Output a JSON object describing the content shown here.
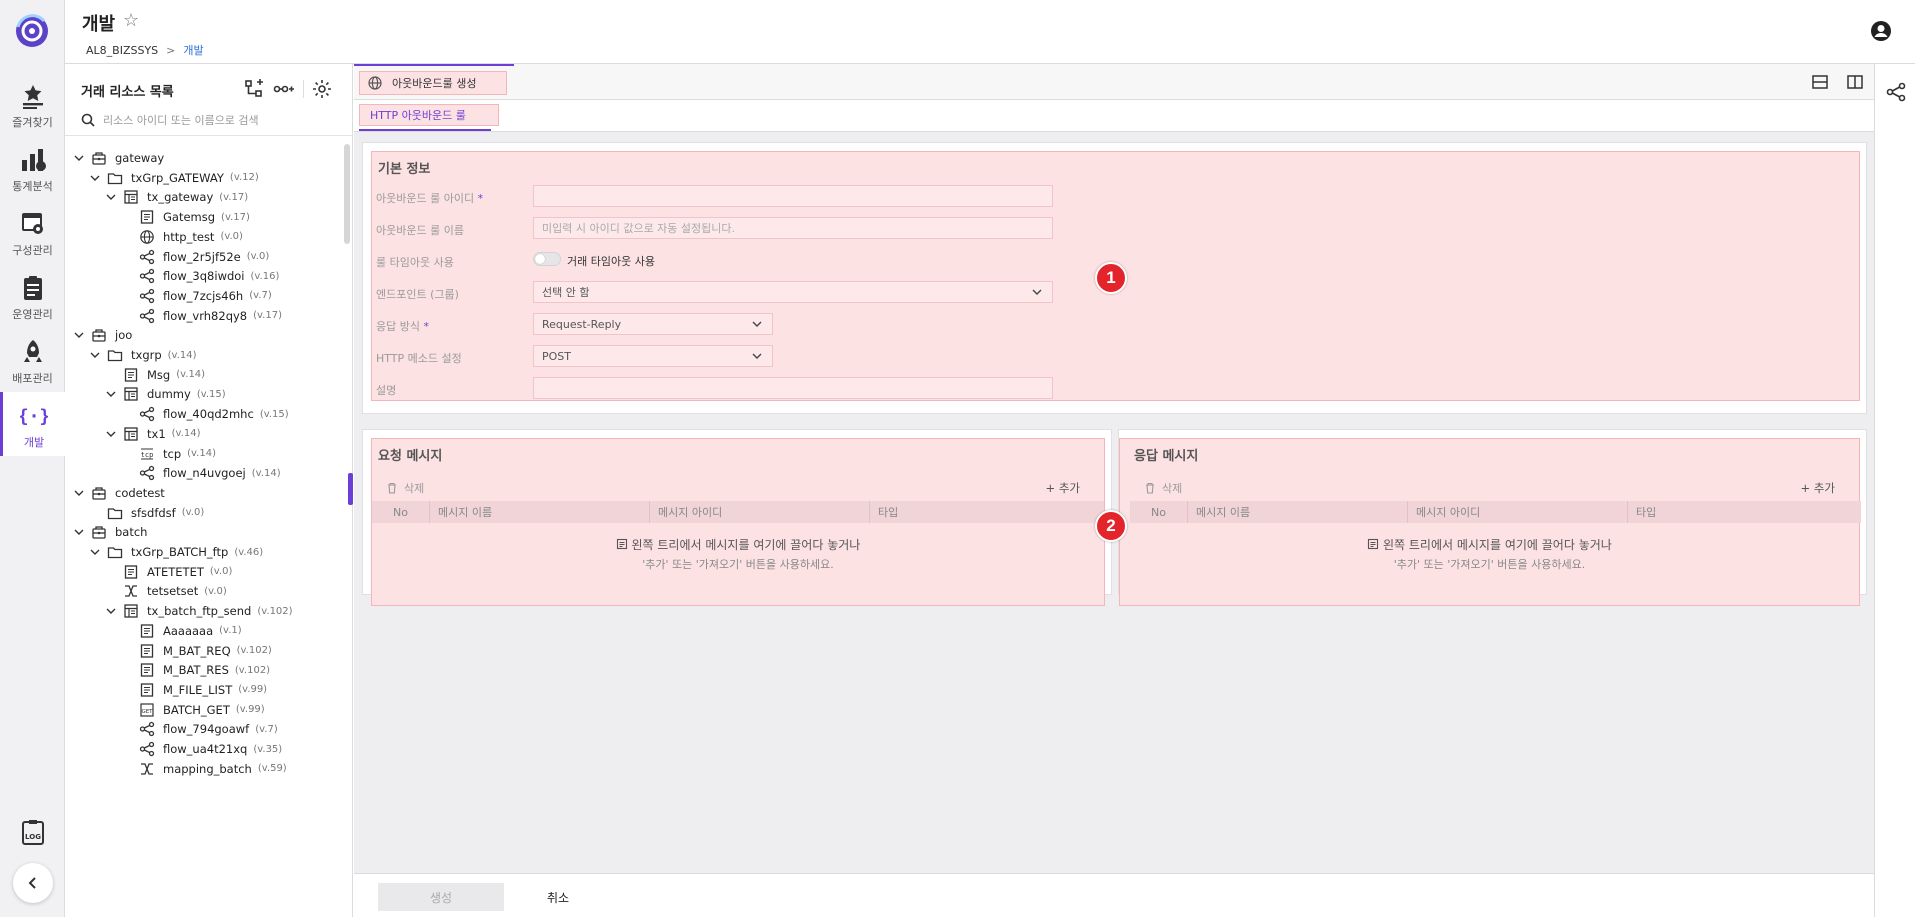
{
  "header": {
    "title": "개발",
    "breadcrumb_root": "AL8_BIZSSYS",
    "breadcrumb_separator": ">",
    "breadcrumb_current": "개발"
  },
  "rail": {
    "items": [
      {
        "label": "즐겨찾기",
        "icon": "favorites-icon"
      },
      {
        "label": "통계분석",
        "icon": "stats-icon"
      },
      {
        "label": "구성관리",
        "icon": "config-icon"
      },
      {
        "label": "운영관리",
        "icon": "operations-icon"
      },
      {
        "label": "배포관리",
        "icon": "deploy-icon"
      },
      {
        "label": "개발",
        "icon": "dev-icon",
        "active": true
      }
    ]
  },
  "tree_panel": {
    "title": "거래 리소스 목록",
    "search_placeholder": "리소스 아이디 또는 이름으로 검색",
    "nodes": [
      {
        "label": "gateway",
        "ver": "",
        "icon": "project-icon",
        "level": 0,
        "expand": true
      },
      {
        "label": "txGrp_GATEWAY",
        "ver": "(v.12)",
        "icon": "folder-icon",
        "level": 1,
        "expand": true
      },
      {
        "label": "tx_gateway",
        "ver": "(v.17)",
        "icon": "transaction-icon",
        "level": 2,
        "expand": true
      },
      {
        "label": "Gatemsg",
        "ver": "(v.17)",
        "icon": "message-icon",
        "level": 3
      },
      {
        "label": "http_test",
        "ver": "(v.0)",
        "icon": "globe-icon",
        "level": 3
      },
      {
        "label": "flow_2r5jf52e",
        "ver": "(v.0)",
        "icon": "flow-icon",
        "level": 3
      },
      {
        "label": "flow_3q8iwdoi",
        "ver": "(v.16)",
        "icon": "flow-icon",
        "level": 3
      },
      {
        "label": "flow_7zcjs46h",
        "ver": "(v.7)",
        "icon": "flow-icon",
        "level": 3
      },
      {
        "label": "flow_vrh82qy8",
        "ver": "(v.17)",
        "icon": "flow-icon",
        "level": 3
      },
      {
        "label": "joo",
        "ver": "",
        "icon": "project-icon",
        "level": 0,
        "expand": true
      },
      {
        "label": "txgrp",
        "ver": "(v.14)",
        "icon": "folder-icon",
        "level": 1,
        "expand": true
      },
      {
        "label": "Msg",
        "ver": "(v.14)",
        "icon": "message-icon",
        "level": 2
      },
      {
        "label": "dummy",
        "ver": "(v.15)",
        "icon": "transaction-icon",
        "level": 2,
        "expand": true
      },
      {
        "label": "flow_40qd2mhc",
        "ver": "(v.15)",
        "icon": "flow-icon",
        "level": 3
      },
      {
        "label": "tx1",
        "ver": "(v.14)",
        "icon": "transaction-icon",
        "level": 2,
        "expand": true
      },
      {
        "label": "tcp",
        "ver": "(v.14)",
        "icon": "tcp-icon",
        "level": 3
      },
      {
        "label": "flow_n4uvgoej",
        "ver": "(v.14)",
        "icon": "flow-icon",
        "level": 3
      },
      {
        "label": "codetest",
        "ver": "",
        "icon": "project-icon",
        "level": 0,
        "expand": true
      },
      {
        "label": "sfsdfdsf",
        "ver": "(v.0)",
        "icon": "folder-icon",
        "level": 1
      },
      {
        "label": "batch",
        "ver": "",
        "icon": "project-icon",
        "level": 0,
        "expand": true
      },
      {
        "label": "txGrp_BATCH_ftp",
        "ver": "(v.46)",
        "icon": "folder-icon",
        "level": 1,
        "expand": true
      },
      {
        "label": "ATETETET",
        "ver": "(v.0)",
        "icon": "message-icon",
        "level": 2
      },
      {
        "label": "tetsetset",
        "ver": "(v.0)",
        "icon": "mapping-icon",
        "level": 2
      },
      {
        "label": "tx_batch_ftp_send",
        "ver": "(v.102)",
        "icon": "transaction-icon",
        "level": 2,
        "expand": true
      },
      {
        "label": "Aaaaaaa",
        "ver": "(v.1)",
        "icon": "message-icon",
        "level": 3
      },
      {
        "label": "M_BAT_REQ",
        "ver": "(v.102)",
        "icon": "message-icon",
        "level": 3
      },
      {
        "label": "M_BAT_RES",
        "ver": "(v.102)",
        "icon": "message-icon",
        "level": 3
      },
      {
        "label": "M_FILE_LIST",
        "ver": "(v.99)",
        "icon": "message-icon",
        "level": 3
      },
      {
        "label": "BATCH_GET",
        "ver": "(v.99)",
        "icon": "batch-icon",
        "level": 3
      },
      {
        "label": "flow_794goawf",
        "ver": "(v.7)",
        "icon": "flow-icon",
        "level": 3
      },
      {
        "label": "flow_ua4t21xq",
        "ver": "(v.35)",
        "icon": "flow-icon",
        "level": 3
      },
      {
        "label": "mapping_batch",
        "ver": "(v.59)",
        "icon": "mapping-icon",
        "level": 3
      }
    ]
  },
  "tabs": {
    "main_tab": "아웃바운드룰 생성",
    "sub_tab": "HTTP 아웃바운드 룰"
  },
  "basic_info": {
    "title": "기본 정보",
    "fields": {
      "rule_id_label": "아웃바운드 룰 아이디",
      "rule_name_label": "아웃바운드 룰 이름",
      "rule_name_placeholder": "미입력 시 아이디 값으로 자동 설정됩니다.",
      "timeout_label": "룰 타임아웃 사용",
      "timeout_toggle_label": "거래 타임아웃 사용",
      "endpoint_label": "엔드포인트 (그룹)",
      "endpoint_value": "선택 안 함",
      "response_label": "응답 방식",
      "response_value": "Request-Reply",
      "http_method_label": "HTTP 메소드 설정",
      "http_method_value": "POST",
      "description_label": "설명"
    },
    "required_mark": "*"
  },
  "markers": [
    "1",
    "2"
  ],
  "request_msg": {
    "title": "요청 메시지",
    "delete_label": "삭제",
    "add_label": "+ 추가",
    "columns": [
      "No",
      "메시지 이름",
      "메시지 아이디",
      "타입"
    ],
    "empty_line1": "왼쪽 트리에서 메시지를 여기에 끌어다 놓거나",
    "empty_line2": "'추가' 또는 '가져오기' 버튼을 사용하세요."
  },
  "response_msg": {
    "title": "응답 메시지",
    "delete_label": "삭제",
    "add_label": "+ 추가",
    "columns": [
      "No",
      "메시지 이름",
      "메시지 아이디",
      "타입"
    ],
    "empty_line1": "왼쪽 트리에서 메시지를 여기에 끌어다 놓거나",
    "empty_line2": "'추가' 또는 '가져오기' 버튼을 사용하세요."
  },
  "footer": {
    "create_label": "생성",
    "cancel_label": "취소"
  },
  "colors": {
    "accent": "#6b3fd6",
    "marker": "#e3242b",
    "highlight_bg": "#fde2e4"
  }
}
